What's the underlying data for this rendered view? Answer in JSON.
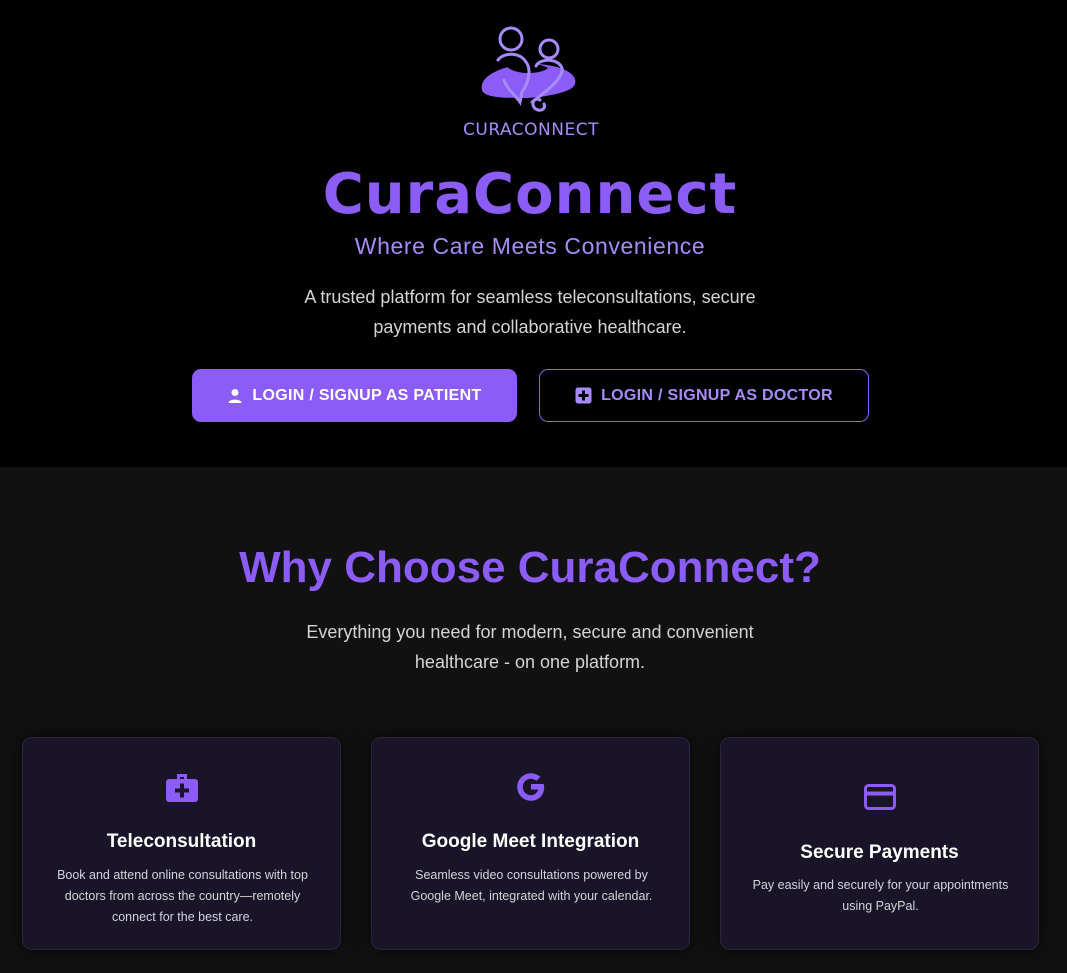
{
  "logo": {
    "wordmark": "CURACONNECT",
    "icon": "family-care-icon"
  },
  "hero": {
    "title": "CuraConnect",
    "tagline": "Where Care Meets Convenience",
    "description": "A trusted platform for seamless teleconsultations, secure payments and collaborative healthcare.",
    "buttons": {
      "patient": {
        "label": "LOGIN / SIGNUP AS PATIENT",
        "icon": "user-icon"
      },
      "doctor": {
        "label": "LOGIN / SIGNUP AS DOCTOR",
        "icon": "medical-plus-icon"
      }
    }
  },
  "features": {
    "title": "Why Choose CuraConnect?",
    "subtitle": "Everything you need for modern, secure and convenient healthcare - on one platform.",
    "cards": [
      {
        "icon": "medical-kit-icon",
        "title": "Teleconsultation",
        "body": "Book and attend online consultations with top doctors from across the country—remotely connect for the best care."
      },
      {
        "icon": "google-icon",
        "title": "Google Meet Integration",
        "body": "Seamless video consultations powered by Google Meet, integrated with your calendar."
      },
      {
        "icon": "credit-card-icon",
        "title": "Secure Payments",
        "body": "Pay easily and securely for your appointments using PayPal."
      }
    ]
  },
  "colors": {
    "accent": "#8b5cf6",
    "accent_light": "#a78bfa",
    "hero_background": "#000000",
    "section_background": "#111112",
    "card_background": "#1a1428",
    "text_muted": "#d4d4d8"
  }
}
